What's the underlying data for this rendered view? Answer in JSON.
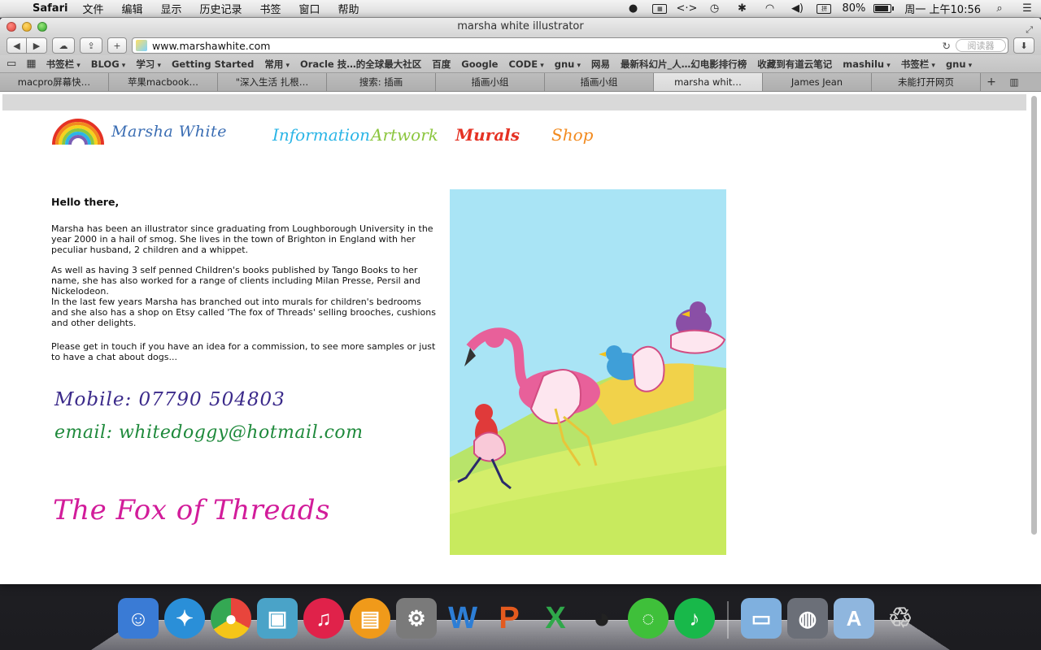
{
  "menubar": {
    "app_name": "Safari",
    "menus": [
      "文件",
      "编辑",
      "显示",
      "历史记录",
      "书签",
      "窗口",
      "帮助"
    ],
    "battery_percent": "80%",
    "clock": "周一 上午10:56",
    "status_icons": [
      "qq-icon",
      "keyboard-icon",
      "code-icon",
      "time-machine-icon",
      "bluetooth-icon",
      "wifi-icon",
      "volume-icon",
      "input-method-icon",
      "battery-icon",
      "spotlight-icon",
      "notification-list-icon"
    ],
    "input_method_label": "拼"
  },
  "window": {
    "title": "marsha white illustrator",
    "url": "www.marshawhite.com",
    "reader_label": "阅读器"
  },
  "bookmarks": [
    {
      "label": "书签栏",
      "menu": true
    },
    {
      "label": "BLOG",
      "menu": true
    },
    {
      "label": "学习",
      "menu": true
    },
    {
      "label": "Getting Started",
      "menu": false
    },
    {
      "label": "常用",
      "menu": true
    },
    {
      "label": "Oracle 技…的全球最大社区",
      "menu": false
    },
    {
      "label": "百度",
      "menu": false
    },
    {
      "label": "Google",
      "menu": false
    },
    {
      "label": "CODE",
      "menu": true
    },
    {
      "label": "gnu",
      "menu": true
    },
    {
      "label": "网易",
      "menu": false
    },
    {
      "label": "最新科幻片_人…幻电影排行榜",
      "menu": false
    },
    {
      "label": "收藏到有道云笔记",
      "menu": false
    },
    {
      "label": "mashilu",
      "menu": true
    },
    {
      "label": "书签栏",
      "menu": true
    },
    {
      "label": "gnu",
      "menu": true
    }
  ],
  "tabs": [
    {
      "label": "macpro屏幕快…",
      "active": false
    },
    {
      "label": "苹果macbook…",
      "active": false
    },
    {
      "label": "\"深入生活 扎根…",
      "active": false
    },
    {
      "label": "搜索: 插画",
      "active": false
    },
    {
      "label": "插画小组",
      "active": false
    },
    {
      "label": "插画小组",
      "active": false
    },
    {
      "label": "marsha whit…",
      "active": true
    },
    {
      "label": "James Jean",
      "active": false
    },
    {
      "label": "未能打开网页",
      "active": false
    }
  ],
  "page": {
    "logo_text": "Marsha White",
    "nav": {
      "information": "Information",
      "artwork": "Artwork",
      "murals": "Murals",
      "shop": "Shop"
    },
    "greeting": "Hello there,",
    "paragraphs": {
      "p1": "Marsha has been an illustrator since graduating from Loughborough University in the year 2000 in a hail of smog. She lives in the town of Brighton in England with her peculiar husband, 2 children and a whippet.",
      "p2": "As well as having 3 self penned Children's books published by Tango Books to her name, she has also worked for a range of clients including Milan Presse, Persil and Nickelodeon.",
      "p3": "In the last few years Marsha has branched out into murals for children's bedrooms and she also has a shop on Etsy called 'The fox of Threads' selling brooches, cushions and other delights.",
      "p4": "Please get in touch if you have an idea for a commission, to see more samples or just to have a chat about dogs..."
    },
    "mobile": "Mobile: 07790 504803",
    "email": "email: whitedoggy@hotmail.com",
    "shop_link": "The Fox of Threads"
  },
  "dock": [
    {
      "name": "finder-icon",
      "glyph": "☺",
      "color": "#3a7bd5"
    },
    {
      "name": "safari-icon",
      "glyph": "✦",
      "color": "#2a8fd8"
    },
    {
      "name": "chrome-icon",
      "glyph": "◉",
      "color": "#e8453c"
    },
    {
      "name": "iphoto-icon",
      "glyph": "▣",
      "color": "#4aa3c8"
    },
    {
      "name": "itunes-icon",
      "glyph": "♫",
      "color": "#e0224a"
    },
    {
      "name": "ibooks-icon",
      "glyph": "▤",
      "color": "#f09a1a"
    },
    {
      "name": "system-preferences-icon",
      "glyph": "⚙",
      "color": "#7a7a7a"
    },
    {
      "name": "word-icon",
      "glyph": "W",
      "color": "#2d7ed6"
    },
    {
      "name": "powerpoint-icon",
      "glyph": "P",
      "color": "#e45a1e"
    },
    {
      "name": "excel-icon",
      "glyph": "X",
      "color": "#2fa84a"
    },
    {
      "name": "qq-icon",
      "glyph": "◕",
      "color": "#222222"
    },
    {
      "name": "wechat-icon",
      "glyph": "◌",
      "color": "#3fc03a"
    },
    {
      "name": "music-icon",
      "glyph": "♪",
      "color": "#18b84a"
    },
    {
      "name": "applications-folder-icon",
      "glyph": "▭",
      "color": "#7fb0df"
    },
    {
      "name": "preview-icon",
      "glyph": "◍",
      "color": "#6b6f78"
    },
    {
      "name": "downloads-folder-icon",
      "glyph": "A",
      "color": "#8fb6de"
    },
    {
      "name": "trash-icon",
      "glyph": "♲",
      "color": "#9a9a9a"
    }
  ],
  "colors": {
    "nav_information": "#2bb5e6",
    "nav_artwork": "#8cc63f",
    "nav_murals": "#e53224",
    "nav_shop": "#f28a1e",
    "mobile": "#3b2a8a",
    "email": "#1f8a3c",
    "shop_link": "#d21c9a"
  }
}
